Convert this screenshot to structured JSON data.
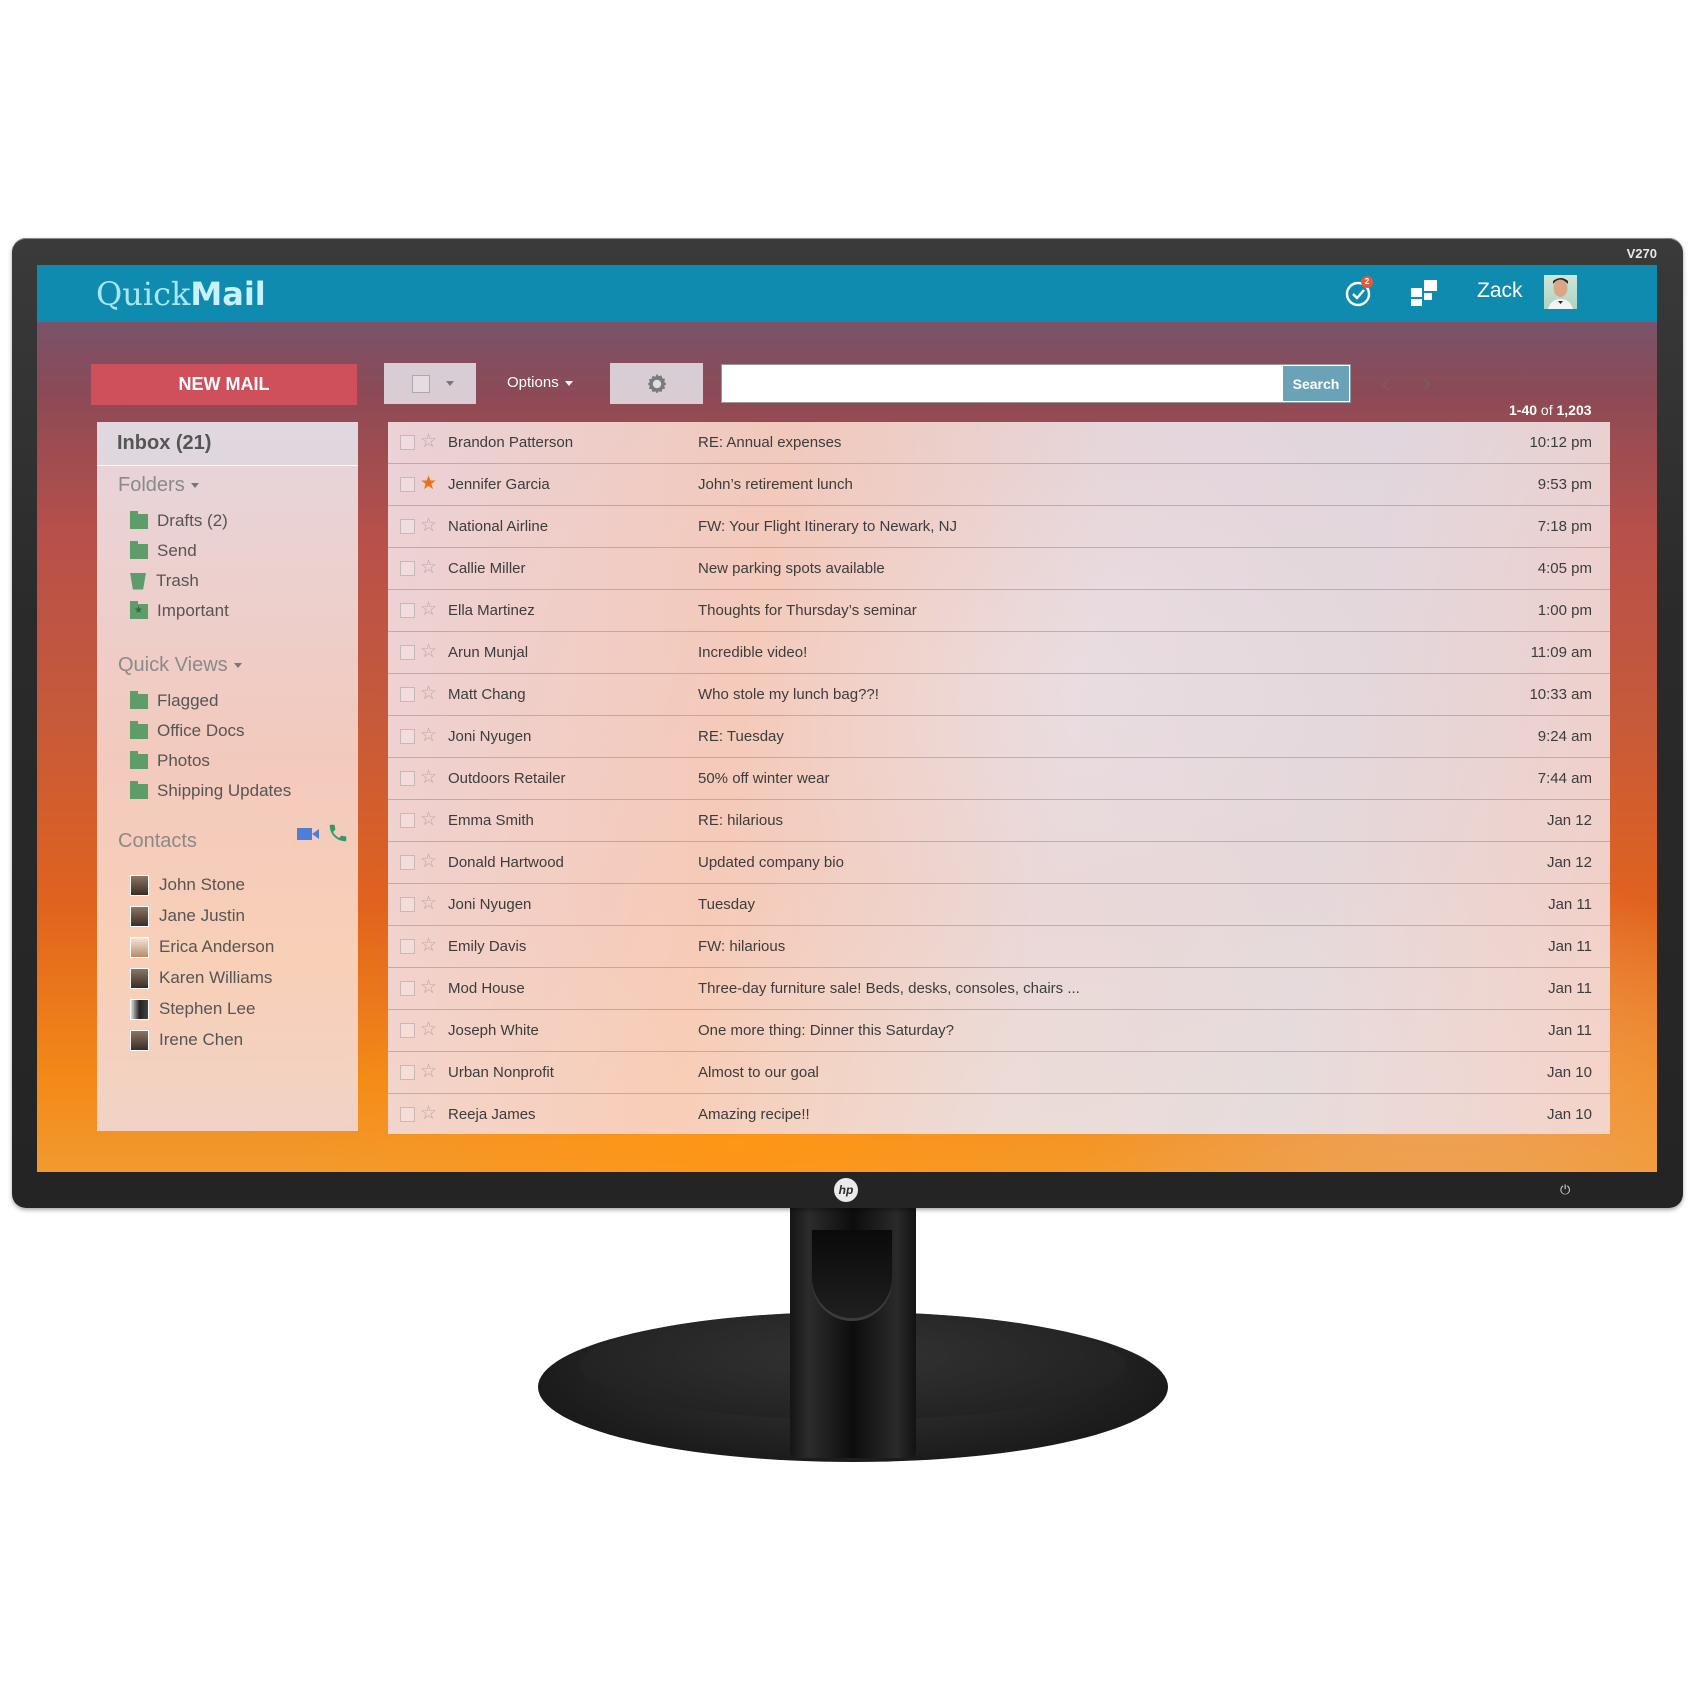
{
  "monitor": {
    "model_label": "V270",
    "brand_logo": "hp",
    "power_icon": "power-icon"
  },
  "app": {
    "logo_part1": "Quick",
    "logo_part2": "Mail",
    "notification_count": "2",
    "user_name": "Zack",
    "colors": {
      "header": "#0f8bb0",
      "new_mail": "#cf4f5a",
      "folder_icon": "#5e9c6a",
      "starred": "#e8721c",
      "search_button": "#6aa3b8"
    }
  },
  "toolbar": {
    "new_mail_label": "NEW MAIL",
    "options_label": "Options",
    "search_placeholder": "",
    "search_value": "",
    "search_button_label": "Search",
    "pager": {
      "range": "1-40",
      "of": "of",
      "total": "1,203"
    }
  },
  "sidebar": {
    "inbox_label": "Inbox (21)",
    "folders_title": "Folders",
    "folders": [
      {
        "label": "Drafts (2)",
        "icon": "folder-icon"
      },
      {
        "label": "Send",
        "icon": "folder-icon"
      },
      {
        "label": "Trash",
        "icon": "trash-icon"
      },
      {
        "label": "Important",
        "icon": "important-folder-icon"
      }
    ],
    "quick_views_title": "Quick Views",
    "quick_views": [
      {
        "label": "Flagged"
      },
      {
        "label": "Office Docs"
      },
      {
        "label": "Photos"
      },
      {
        "label": "Shipping Updates"
      }
    ],
    "contacts_title": "Contacts",
    "contacts": [
      {
        "name": "John Stone"
      },
      {
        "name": "Jane Justin"
      },
      {
        "name": "Erica Anderson"
      },
      {
        "name": "Karen Williams"
      },
      {
        "name": "Stephen Lee"
      },
      {
        "name": "Irene Chen"
      }
    ]
  },
  "emails": [
    {
      "sender": "Brandon Patterson",
      "subject": "RE: Annual expenses",
      "time": "10:12 pm",
      "starred": false
    },
    {
      "sender": "Jennifer Garcia",
      "subject": "John’s retirement lunch",
      "time": "9:53 pm",
      "starred": true
    },
    {
      "sender": "National Airline",
      "subject": "FW: Your Flight Itinerary to Newark, NJ",
      "time": "7:18 pm",
      "starred": false
    },
    {
      "sender": "Callie Miller",
      "subject": "New parking spots available",
      "time": "4:05 pm",
      "starred": false
    },
    {
      "sender": "Ella Martinez",
      "subject": "Thoughts for Thursday’s seminar",
      "time": "1:00 pm",
      "starred": false
    },
    {
      "sender": "Arun Munjal",
      "subject": "Incredible video!",
      "time": "11:09 am",
      "starred": false
    },
    {
      "sender": "Matt Chang",
      "subject": "Who stole my lunch bag??!",
      "time": "10:33 am",
      "starred": false
    },
    {
      "sender": "Joni Nyugen",
      "subject": "RE: Tuesday",
      "time": "9:24 am",
      "starred": false
    },
    {
      "sender": "Outdoors Retailer",
      "subject": "50% off winter wear",
      "time": "7:44 am",
      "starred": false
    },
    {
      "sender": "Emma Smith",
      "subject": "RE: hilarious",
      "time": "Jan 12",
      "starred": false
    },
    {
      "sender": "Donald Hartwood",
      "subject": "Updated company bio",
      "time": "Jan 12",
      "starred": false
    },
    {
      "sender": "Joni Nyugen",
      "subject": "Tuesday",
      "time": "Jan 11",
      "starred": false
    },
    {
      "sender": "Emily Davis",
      "subject": "FW: hilarious",
      "time": "Jan 11",
      "starred": false
    },
    {
      "sender": "Mod House",
      "subject": "Three-day furniture sale! Beds, desks, consoles, chairs ...",
      "time": "Jan 11",
      "starred": false
    },
    {
      "sender": "Joseph White",
      "subject": "One more thing: Dinner this Saturday?",
      "time": "Jan 11",
      "starred": false
    },
    {
      "sender": "Urban Nonprofit",
      "subject": "Almost to our goal",
      "time": "Jan 10",
      "starred": false
    },
    {
      "sender": "Reeja James",
      "subject": "Amazing recipe!!",
      "time": "Jan 10",
      "starred": false
    }
  ]
}
